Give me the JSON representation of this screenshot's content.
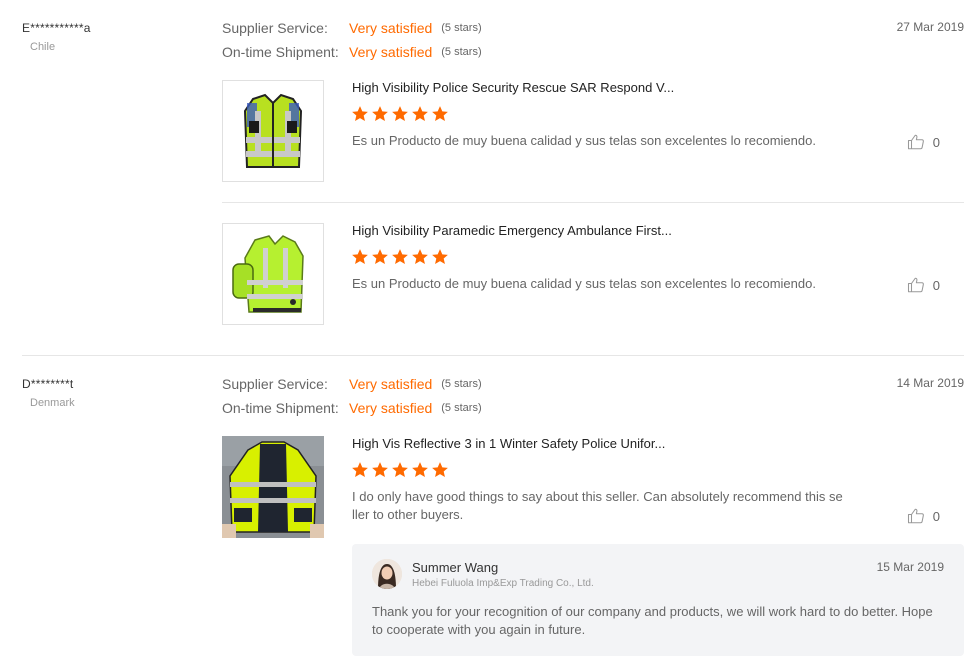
{
  "reviews": [
    {
      "name": "E***********a",
      "country": "Chile",
      "date": "27 Mar 2019",
      "supplier_service": {
        "label": "Supplier Service:",
        "value": "Very satisfied",
        "stars": "(5 stars)"
      },
      "on_time_shipment": {
        "label": "On-time Shipment:",
        "value": "Very satisfied",
        "stars": "(5 stars)"
      },
      "products": [
        {
          "title": "High Visibility Police Security Rescue SAR Respond V...",
          "rating": 5,
          "text": "Es un Producto de muy buena calidad y sus telas son excelentes lo recomiendo.",
          "likes": "0"
        },
        {
          "title": "High Visibility Paramedic Emergency Ambulance First...",
          "rating": 5,
          "text": "Es un Producto de muy buena calidad y sus telas son excelentes lo recomiendo.",
          "likes": "0"
        }
      ]
    },
    {
      "name": "D********t",
      "country": "Denmark",
      "date": "14 Mar 2019",
      "supplier_service": {
        "label": "Supplier Service:",
        "value": "Very satisfied",
        "stars": "(5 stars)"
      },
      "on_time_shipment": {
        "label": "On-time Shipment:",
        "value": "Very satisfied",
        "stars": "(5 stars)"
      },
      "products": [
        {
          "title": "High Vis Reflective 3 in 1 Winter Safety Police Unifor...",
          "rating": 5,
          "text": "I do only have good things to say about this seller. Can absolutely recommend this seller to other buyers.",
          "likes": "0"
        }
      ],
      "reply": {
        "name": "Summer Wang",
        "company": "Hebei Fuluola Imp&Exp Trading Co., Ltd.",
        "date": "15 Mar 2019",
        "text": "Thank you for your recognition of our company and products, we will work hard to do better. Hope to cooperate with you again in future."
      }
    }
  ],
  "colors": {
    "accent": "#ff6a00",
    "star": "#ff6a00",
    "divider": "#e6e6e6",
    "reply_bg": "#f3f4f6"
  },
  "icons": {
    "star": "star-icon",
    "like": "thumbs-up-icon",
    "avatar": "avatar"
  }
}
